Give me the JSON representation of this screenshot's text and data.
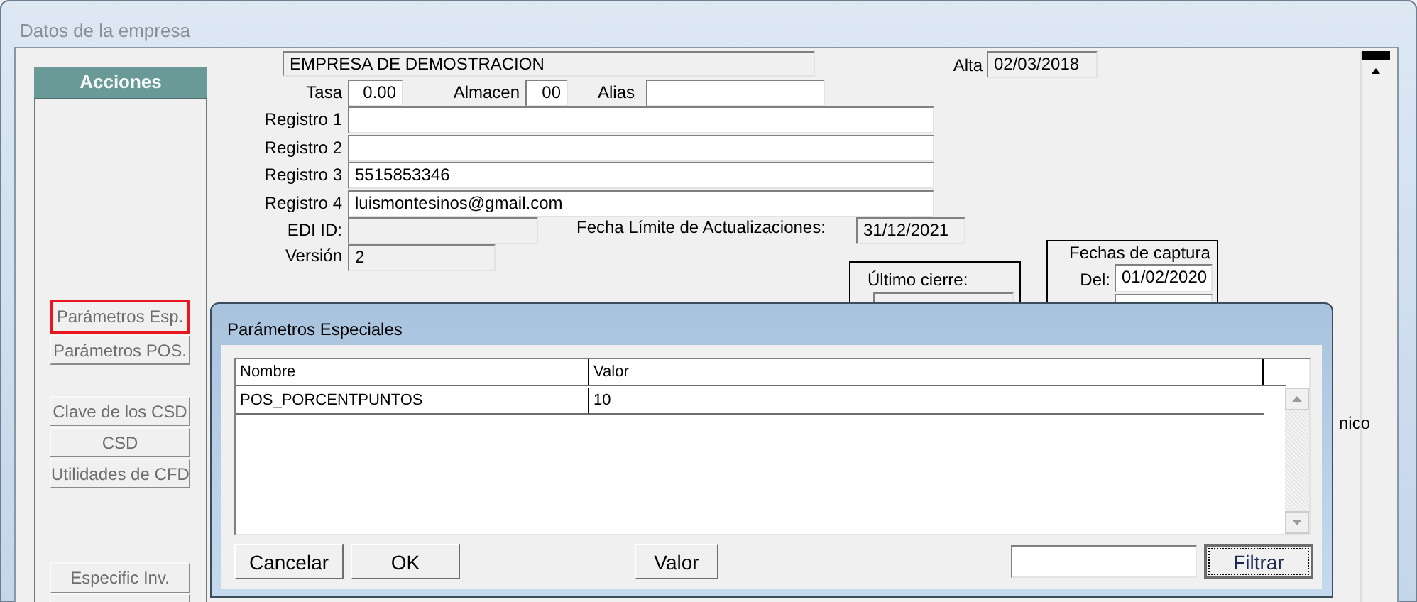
{
  "window": {
    "title": "Datos de la empresa"
  },
  "actions": {
    "title": "Acciones",
    "buttons": [
      {
        "label": "Parámetros Esp.",
        "highlighted": true
      },
      {
        "label": "Parámetros POS.",
        "highlighted": false
      },
      {
        "label": "Clave de los CSD",
        "highlighted": false
      },
      {
        "label": "CSD",
        "highlighted": false
      },
      {
        "label": "Utilidades de CFD",
        "highlighted": false
      },
      {
        "label": "Especific Inv.",
        "highlighted": false
      }
    ]
  },
  "company": {
    "name": "EMPRESA DE DEMOSTRACION",
    "alta_label": "Alta",
    "alta": "02/03/2018",
    "tasa_label": "Tasa",
    "tasa": "0.00",
    "almacen_label": "Almacen",
    "almacen": "00",
    "alias_label": "Alias"
  },
  "registros": [
    {
      "label": "Registro 1"
    },
    {
      "label": "Registro 2"
    },
    {
      "label": "Registro 3",
      "value": "5515853346"
    },
    {
      "label": "Registro 4",
      "value": "luismontesinos@gmail.com"
    }
  ],
  "edi": {
    "label": "EDI ID:"
  },
  "fecha_limite": {
    "label": "Fecha Límite de Actualizaciones:",
    "value": "31/12/2021"
  },
  "version": {
    "label": "Versión",
    "value": "2"
  },
  "ultimo_cierre": {
    "label": "Último cierre:"
  },
  "fechas_captura": {
    "title": "Fechas de captura",
    "del_label": "Del:",
    "del": "01/02/2020"
  },
  "cut_label": "nico",
  "dialog": {
    "title": "Parámetros Especiales",
    "columns": [
      "Nombre",
      "Valor"
    ],
    "rows": [
      [
        "POS_PORCENTPUNTOS",
        "10"
      ]
    ],
    "buttons": [
      "Cancelar",
      "OK",
      "Valor"
    ],
    "filter_button": "Filtrar"
  }
}
